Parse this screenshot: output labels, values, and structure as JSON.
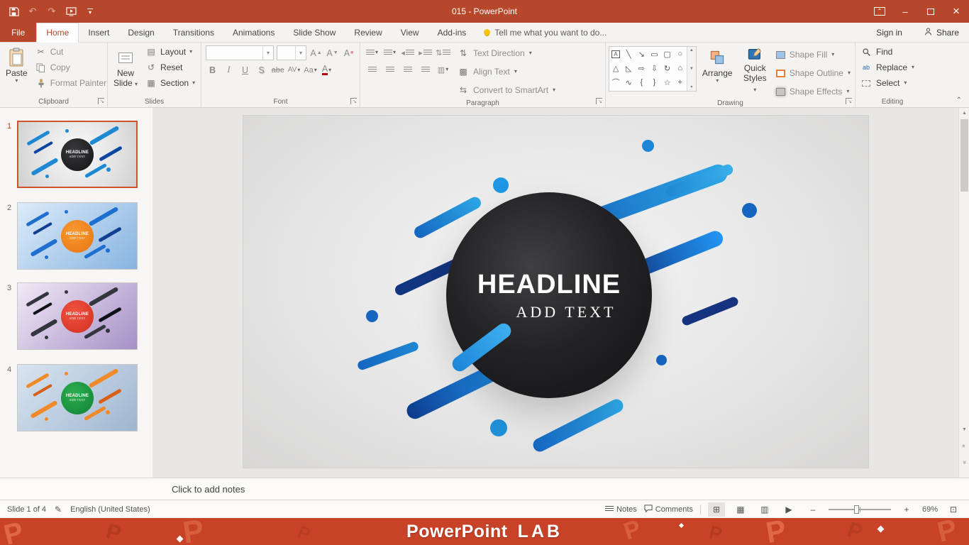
{
  "colors": {
    "titlebar": "#B7472A",
    "accent": "#B7472A",
    "selection_border": "#D0512F",
    "banner": "#C84227",
    "capsule_blue": "#1E88D2",
    "capsule_navy": "#123F8F",
    "circle_dark": "#1B1B1D"
  },
  "titlebar": {
    "title": "015 - PowerPoint"
  },
  "tabs": {
    "file": "File",
    "home": "Home",
    "insert": "Insert",
    "design": "Design",
    "transitions": "Transitions",
    "animations": "Animations",
    "slide_show": "Slide Show",
    "review": "Review",
    "view": "View",
    "add_ins": "Add-ins",
    "tell_me": "Tell me what you want to do...",
    "sign_in": "Sign in",
    "share": "Share"
  },
  "clipboard": {
    "label": "Clipboard",
    "paste": "Paste",
    "cut": "Cut",
    "copy": "Copy",
    "format_painter": "Format Painter"
  },
  "slides": {
    "label": "Slides",
    "new_slide_top": "New",
    "new_slide_bottom": "Slide",
    "layout": "Layout",
    "reset": "Reset",
    "section": "Section"
  },
  "font": {
    "label": "Font",
    "grow": "A",
    "shrink": "A",
    "clear": "A",
    "bold": "B",
    "italic": "I",
    "underline": "U",
    "shadow": "S",
    "strikethrough": "abc",
    "char_spacing": "AV",
    "change_case": "Aa",
    "font_color": "A"
  },
  "paragraph": {
    "label": "Paragraph",
    "text_direction": "Text Direction",
    "align_text": "Align Text",
    "smartart": "Convert to SmartArt"
  },
  "drawing": {
    "label": "Drawing",
    "arrange": "Arrange",
    "quick_top": "Quick",
    "quick_bottom": "Styles",
    "shape_fill": "Shape Fill",
    "shape_outline": "Shape Outline",
    "shape_effects": "Shape Effects"
  },
  "editing": {
    "label": "Editing",
    "find": "Find",
    "replace": "Replace",
    "select": "Select"
  },
  "slide": {
    "headline": "HEADLINE",
    "add_text": "ADD TEXT"
  },
  "thumbnails": [
    {
      "n": "1"
    },
    {
      "n": "2"
    },
    {
      "n": "3"
    },
    {
      "n": "4"
    }
  ],
  "notes": {
    "placeholder": "Click to add notes"
  },
  "status": {
    "slide_info": "Slide 1 of 4",
    "language": "English (United States)",
    "notes": "Notes",
    "comments": "Comments",
    "zoom": "69%"
  },
  "banner": {
    "brand": "PowerPoint",
    "lab": "LAB"
  }
}
